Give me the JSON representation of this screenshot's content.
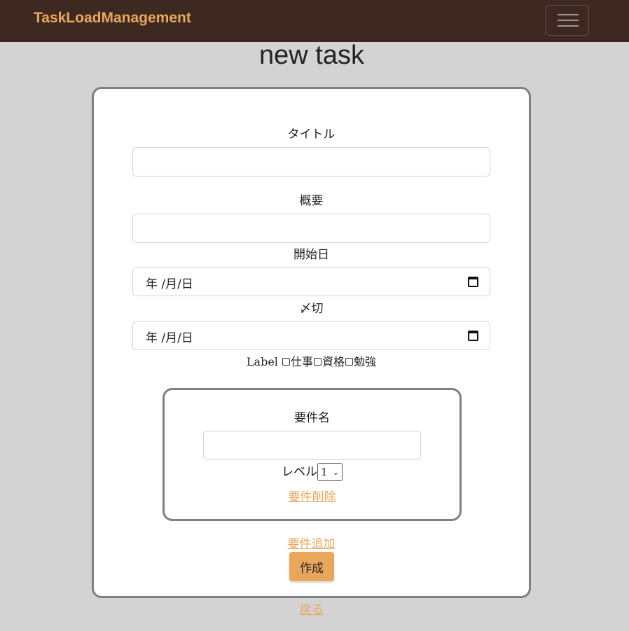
{
  "navbar": {
    "brand": "TaskLoadManagement",
    "menu_icon": "hamburger-menu-icon"
  },
  "page": {
    "title": "new task"
  },
  "form": {
    "title_label": "タイトル",
    "title_value": "",
    "summary_label": "概要",
    "summary_value": "",
    "start_label": "開始日",
    "start_value": "年 /月/日",
    "deadline_label": "〆切",
    "deadline_value": "年 /月/日",
    "label_prefix": "Label",
    "label_options": [
      "仕事",
      "資格",
      "勉強"
    ],
    "requirement": {
      "name_label": "要件名",
      "name_value": "",
      "level_label": "レベル",
      "level_value": "1",
      "delete_link": "要件削除"
    },
    "add_requirement_link": "要件追加",
    "submit_label": "作成"
  },
  "back_link": "戻る",
  "colors": {
    "navbar_bg": "#3e2922",
    "accent": "#e8a75a",
    "page_bg": "#d3d3d3"
  }
}
